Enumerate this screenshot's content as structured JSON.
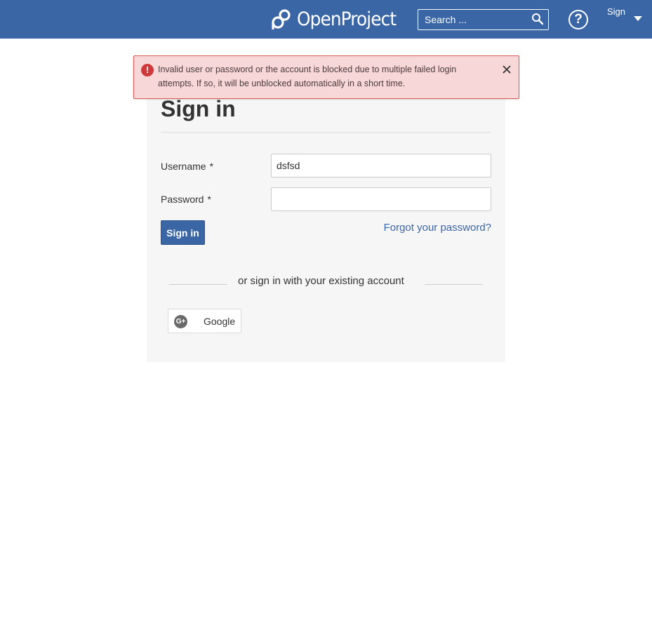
{
  "header": {
    "logo_text": "OpenProject",
    "search_placeholder": "Search ...",
    "signin_menu_label": "Sign in"
  },
  "flash": {
    "message": "Invalid user or password or the account is blocked due to multiple failed login attempts. If so, it will be unblocked automatically in a short time."
  },
  "login": {
    "title": "Sign in",
    "username_label": "Username",
    "username_value": "dsfsd",
    "password_label": "Password",
    "password_value": "",
    "required_mark": "*",
    "submit_label": "Sign in",
    "forgot_label": "Forgot your password?",
    "alt_signin_text": "or sign in with your existing account",
    "google_label": "Google"
  },
  "colors": {
    "header_bg": "#3a66a6",
    "error_bg": "#f8d7d8",
    "error_border": "#d95a5a",
    "link": "#3a66a6"
  }
}
